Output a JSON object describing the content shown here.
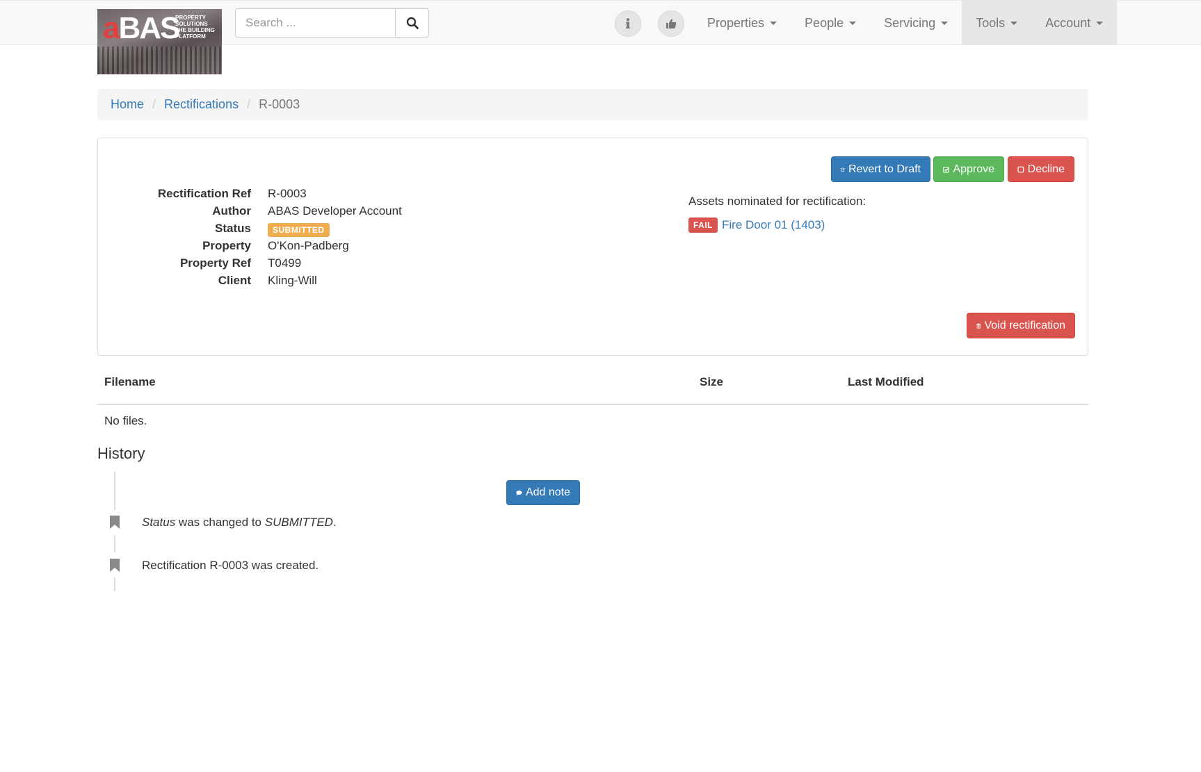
{
  "navbar": {
    "brand": {
      "logo_a": "a",
      "logo_bas": "BAS",
      "tagline": "PROPERTY SOLUTIONS THE BUILDING PLATFORM"
    },
    "search": {
      "placeholder": "Search ..."
    },
    "icons": [
      "search-icon",
      "info-icon",
      "thumbs-up-icon"
    ],
    "menu": [
      {
        "label": "Properties"
      },
      {
        "label": "People"
      },
      {
        "label": "Servicing"
      },
      {
        "label": "Tools"
      },
      {
        "label": "Account"
      }
    ]
  },
  "breadcrumb": {
    "home": "Home",
    "section": "Rectifications",
    "current": "R-0003",
    "separator": "/"
  },
  "actions": {
    "revert": "Revert to Draft",
    "approve": "Approve",
    "decline": "Decline",
    "void": "Void rectification"
  },
  "details": {
    "rows": [
      {
        "label": "Rectification Ref",
        "value": "R-0003"
      },
      {
        "label": "Author",
        "value": "ABAS Developer Account"
      },
      {
        "label": "Status",
        "value": "SUBMITTED"
      },
      {
        "label": "Property",
        "value": "O'Kon-Padberg"
      },
      {
        "label": "Property Ref",
        "value": "T0499"
      },
      {
        "label": "Client",
        "value": "Kling-Will"
      }
    ]
  },
  "assets": {
    "title": "Assets nominated for rectification:",
    "items": [
      {
        "status": "FAIL",
        "name": "Fire Door 01 (1403)"
      }
    ]
  },
  "files": {
    "columns": [
      "Filename",
      "Size",
      "Last Modified"
    ],
    "empty": "No files."
  },
  "history": {
    "title": "History",
    "add_note": "Add note",
    "entries": [
      {
        "field": "Status",
        "middle": " was changed to ",
        "value": "SUBMITTED",
        "end": "."
      },
      {
        "text": "Rectification R-0003 was created."
      }
    ]
  },
  "colors": {
    "primary": "#337ab7",
    "success": "#5cb85c",
    "danger": "#d9534f",
    "warning": "#f0ad4e"
  }
}
